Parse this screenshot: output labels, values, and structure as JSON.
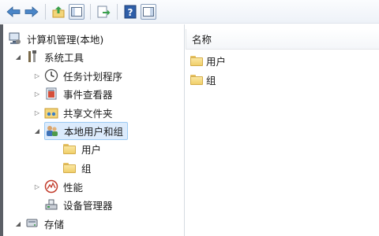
{
  "toolbar": {
    "buttons": [
      "back-icon",
      "forward-icon",
      "up-folder-icon",
      "show-hide-tree-icon",
      "export-list-icon",
      "help-icon",
      "show-hide-action-pane-icon"
    ]
  },
  "tree": {
    "root": {
      "label": "计算机管理(本地)"
    },
    "system_tools": {
      "label": "系统工具"
    },
    "task_scheduler": {
      "label": "任务计划程序"
    },
    "event_viewer": {
      "label": "事件查看器"
    },
    "shared_folders": {
      "label": "共享文件夹"
    },
    "local_users_groups": {
      "label": "本地用户和组"
    },
    "users": {
      "label": "用户"
    },
    "groups": {
      "label": "组"
    },
    "performance": {
      "label": "性能"
    },
    "device_manager": {
      "label": "设备管理器"
    },
    "storage": {
      "label": "存储"
    }
  },
  "list": {
    "column_name": "名称",
    "items": [
      {
        "label": "用户"
      },
      {
        "label": "组"
      }
    ]
  },
  "colors": {
    "selection_bg": "#dcebfc",
    "selection_border": "#9ccaf3",
    "folder": "#f0cf6a"
  }
}
